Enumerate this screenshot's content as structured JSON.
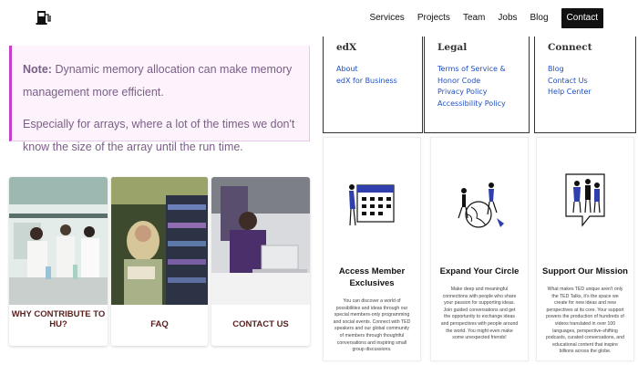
{
  "nav": {
    "logo_icon": "fuel-pump-icon",
    "links": [
      "Services",
      "Projects",
      "Team",
      "Jobs",
      "Blog"
    ],
    "cta": "Contact"
  },
  "note": {
    "label": "Note:",
    "text1": "Dynamic memory allocation can make memory management more efficient.",
    "text2": "Especially for arrays, where a lot of the times we don't know the size of the array until the run time.",
    "accent": "#c53ec7"
  },
  "photo_cards": [
    {
      "label": "WHY CONTRIBUTE TO HU?"
    },
    {
      "label": "FAQ"
    },
    {
      "label": "CONTACT US"
    }
  ],
  "footer": {
    "columns": [
      {
        "title": "edX",
        "links": [
          "About",
          "edX for Business"
        ]
      },
      {
        "title": "Legal",
        "links": [
          "Terms of Service &",
          "Honor Code",
          "Privacy Policy",
          "Accessibility Policy"
        ]
      },
      {
        "title": "Connect",
        "links": [
          "Blog",
          "Contact Us",
          "Help Center"
        ]
      }
    ]
  },
  "features": [
    {
      "title_line1": "Access Member",
      "title_line2": "Exclusives",
      "desc": "You can discover a world of possibilities and ideas through our special members-only programming and social events. Connect with TED speakers and our global community of members through thoughtful conversations and inspiring small group discussions."
    },
    {
      "title_line1": "Expand Your Circle",
      "title_line2": "",
      "desc": "Make deep and meaningful connections with people who share your passion for supporting ideas. Join guided conversations and get the opportunity to exchange ideas and perspectives with people around the world. You might even make some unexpected friends!"
    },
    {
      "title_line1": "Support Our Mission",
      "title_line2": "",
      "desc": "What makes TED unique aren't only the TED Talks, it's the space we create for new ideas and new perspectives at its core. Your support powers the production of hundreds of videos translated in over 100 languages, perspective-shifting podcasts, curated conversations, and educational content that inspire billions across the globe."
    }
  ]
}
